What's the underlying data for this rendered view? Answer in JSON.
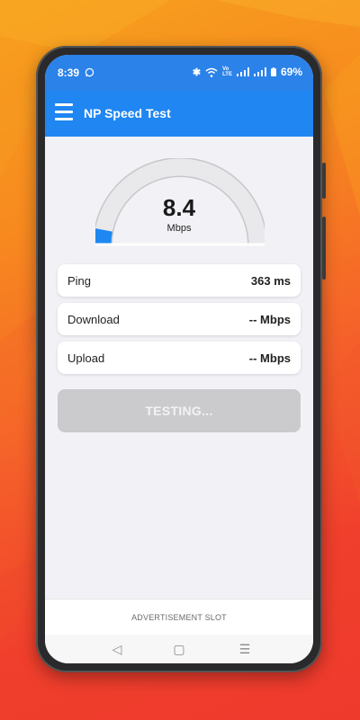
{
  "status_bar": {
    "time": "8:39",
    "battery": "69%",
    "icons": [
      "whatsapp-icon",
      "bluetooth-icon",
      "wifi-icon",
      "volte-icon",
      "signal-icon",
      "signal-icon",
      "battery-icon"
    ]
  },
  "app_bar": {
    "title": "NP Speed Test",
    "menu_icon": "hamburger-menu-icon"
  },
  "gauge": {
    "value": "8.4",
    "unit": "Mbps",
    "level_fraction": 0.06,
    "active_color": "#1e88f0",
    "track_color": "#e8e8ea"
  },
  "metrics": [
    {
      "label": "Ping",
      "value": "363 ms"
    },
    {
      "label": "Download",
      "value": "-- Mbps"
    },
    {
      "label": "Upload",
      "value": "-- Mbps"
    }
  ],
  "test_button": {
    "label": "TESTING..."
  },
  "ad": {
    "label": "ADVERTISEMENT SLOT"
  },
  "nav": {
    "back_glyph": "◁",
    "home_glyph": "▢",
    "recents_glyph": "☰"
  },
  "colors": {
    "app_bar": "#1f86f2",
    "status_bar": "#2b82e9",
    "background_gradient": [
      "#f7a11d",
      "#ee3a2d"
    ],
    "button_disabled": "#cbcbcd"
  }
}
